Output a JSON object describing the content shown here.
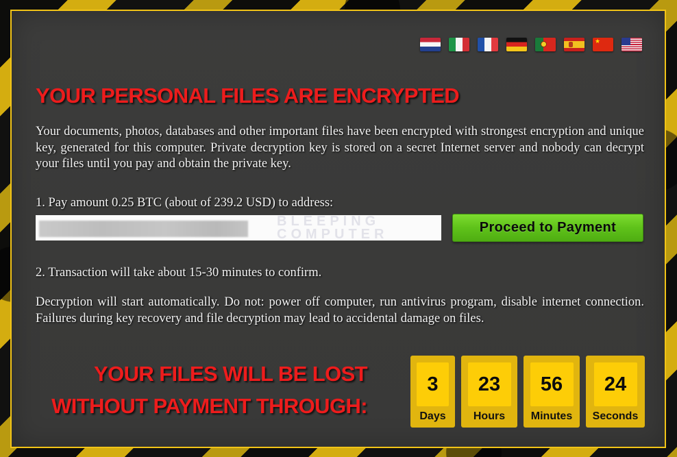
{
  "flags": [
    {
      "language": "Dutch",
      "icon": "flag-netherlands-icon"
    },
    {
      "language": "Italian",
      "icon": "flag-italy-icon"
    },
    {
      "language": "French",
      "icon": "flag-france-icon"
    },
    {
      "language": "German",
      "icon": "flag-germany-icon"
    },
    {
      "language": "Portuguese",
      "icon": "flag-portugal-icon"
    },
    {
      "language": "Spanish",
      "icon": "flag-spain-icon"
    },
    {
      "language": "Chinese",
      "icon": "flag-china-icon"
    },
    {
      "language": "English",
      "icon": "flag-usa-icon"
    }
  ],
  "header": {
    "title": "YOUR PERSONAL FILES ARE ENCRYPTED"
  },
  "content": {
    "intro": "Your documents, photos, databases and other important files have been encrypted with strongest encryption and unique key, generated for this computer. Private decryption key is stored on a secret Internet server and nobody can decrypt your files until you pay and obtain the private key.",
    "step1": "1. Pay amount 0.25 BTC (about of 239.2 USD) to address:",
    "step2": "2. Transaction will take about 15-30 minutes to confirm.",
    "warning": "Decryption will start automatically. Do not: power off computer, run antivirus program, disable internet connection. Failures during key recovery and file decryption may lead to accidental damage on files."
  },
  "payment": {
    "address_value": "",
    "address_obscured": true,
    "watermark_line1": "BLEEPING",
    "watermark_line2": "COMPUTER",
    "button_label": "Proceed to Payment",
    "button_color": "#5fc21a"
  },
  "deadline": {
    "line1": "YOUR FILES WILL BE LOST",
    "line2": "WITHOUT PAYMENT THROUGH:"
  },
  "timer": {
    "days": {
      "value": "3",
      "label": "Days"
    },
    "hours": {
      "value": "23",
      "label": "Hours"
    },
    "minutes": {
      "value": "56",
      "label": "Minutes"
    },
    "seconds": {
      "value": "24",
      "label": "Seconds"
    }
  },
  "colors": {
    "alert_red": "#ed1c1c",
    "panel_bg": "#3b3b3a",
    "border_yellow": "#f2c417",
    "timer_yellow": "#fdcd07"
  }
}
